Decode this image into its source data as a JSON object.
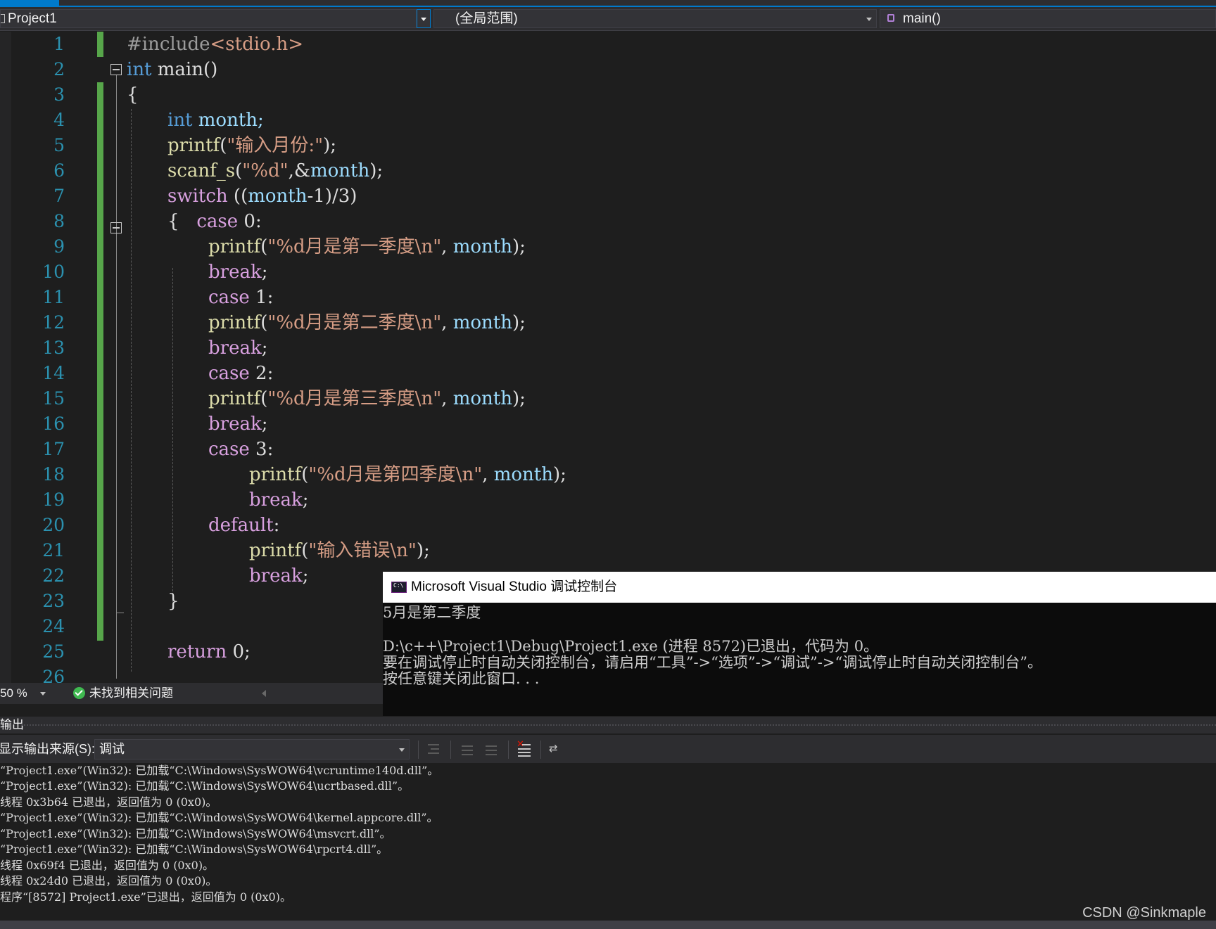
{
  "nav": {
    "project": "Project1",
    "scope": "(全局范围)",
    "function": "main()"
  },
  "editor": {
    "line_numbers": [
      "1",
      "2",
      "3",
      "4",
      "5",
      "6",
      "7",
      "8",
      "9",
      "10",
      "11",
      "12",
      "13",
      "14",
      "15",
      "16",
      "17",
      "18",
      "19",
      "20",
      "21",
      "22",
      "23",
      "24",
      "25",
      "26"
    ],
    "code": {
      "l1": [
        "#include",
        "<stdio.h>"
      ],
      "l2": [
        "int",
        " main()"
      ],
      "l3": [
        "{"
      ],
      "l4": [
        "int",
        " month;"
      ],
      "l5": [
        "printf",
        "(",
        "\"输入月份:\"",
        ");"
      ],
      "l6": [
        "scanf_s",
        "(",
        "\"%d\"",
        ",&",
        "month",
        ");"
      ],
      "l7": [
        "switch",
        " ((",
        "month",
        "-1)/3)"
      ],
      "l8": [
        "{   ",
        "case",
        " 0:"
      ],
      "l9": [
        "printf",
        "(",
        "\"%d月是第一季度\\n\"",
        ", ",
        "month",
        ");"
      ],
      "l10": [
        "break",
        ";"
      ],
      "l11": [
        "case",
        " 1:"
      ],
      "l12": [
        "printf",
        "(",
        "\"%d月是第二季度\\n\"",
        ", ",
        "month",
        ");"
      ],
      "l13": [
        "break",
        ";"
      ],
      "l14": [
        "case",
        " 2:"
      ],
      "l15": [
        "printf",
        "(",
        "\"%d月是第三季度\\n\"",
        ", ",
        "month",
        ");"
      ],
      "l16": [
        "break",
        ";"
      ],
      "l17": [
        "case",
        " 3:"
      ],
      "l18": [
        "printf",
        "(",
        "\"%d月是第四季度\\n\"",
        ", ",
        "month",
        ");"
      ],
      "l19": [
        "break",
        ";"
      ],
      "l20": [
        "default",
        ":"
      ],
      "l21": [
        "printf",
        "(",
        "\"输入错误\\n\"",
        ");"
      ],
      "l22": [
        "break",
        ";"
      ],
      "l23": [
        "}"
      ],
      "l25": [
        "return",
        " 0;"
      ]
    }
  },
  "status": {
    "zoom": "50 %",
    "issues": "未找到相关问题"
  },
  "console": {
    "title": "Microsoft Visual Studio 调试控制台",
    "lines": [
      "5月是第二季度",
      "",
      "D:\\c++\\Project1\\Debug\\Project1.exe (进程 8572)已退出，代码为 0。",
      "要在调试停止时自动关闭控制台，请启用“工具”->“选项”->“调试”->“调试停止时自动关闭控制台”。",
      "按任意键关闭此窗口. . ."
    ]
  },
  "output": {
    "header": "输出",
    "source_label": "显示输出来源(S):",
    "source_value": "调试",
    "lines": [
      "“Project1.exe”(Win32): 已加载“C:\\Windows\\SysWOW64\\vcruntime140d.dll”。",
      "“Project1.exe”(Win32): 已加载“C:\\Windows\\SysWOW64\\ucrtbased.dll”。",
      "线程 0x3b64 已退出，返回值为 0 (0x0)。",
      "“Project1.exe”(Win32): 已加载“C:\\Windows\\SysWOW64\\kernel.appcore.dll”。",
      "“Project1.exe”(Win32): 已加载“C:\\Windows\\SysWOW64\\msvcrt.dll”。",
      "“Project1.exe”(Win32): 已加载“C:\\Windows\\SysWOW64\\rpcrt4.dll”。",
      "线程 0x69f4 已退出，返回值为 0 (0x0)。",
      "线程 0x24d0 已退出，返回值为 0 (0x0)。",
      "程序“[8572] Project1.exe”已退出，返回值为 0 (0x0)。"
    ]
  },
  "watermark": "CSDN @Sinkmaple",
  "colors": {
    "keyword": "#569cd6",
    "control": "#d8a0df",
    "function": "#dcdcaa",
    "string": "#d69d85",
    "variable": "#9cdcfe",
    "line_number": "#2b91af",
    "change_bar": "#57a64a",
    "accent": "#007acc"
  }
}
